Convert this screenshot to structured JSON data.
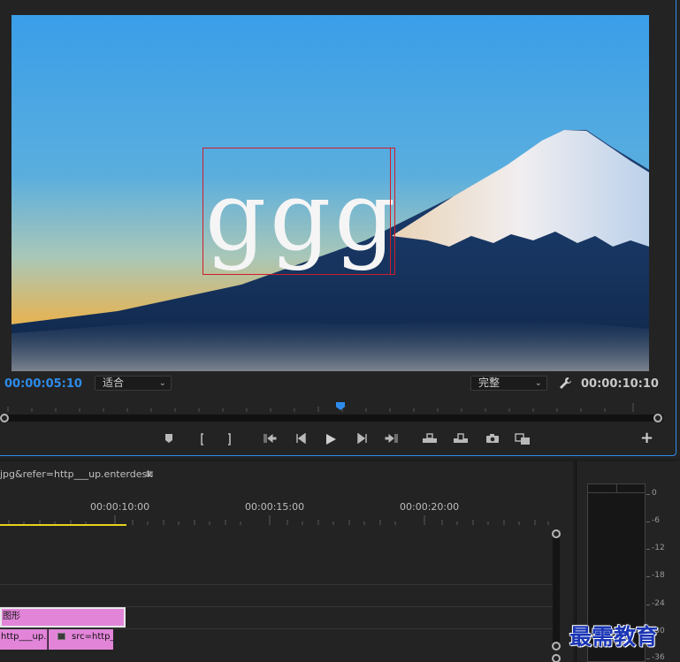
{
  "program_monitor": {
    "overlay_text": "ggg",
    "current_timecode": "00:00:05:10",
    "duration_timecode": "00:00:10:10",
    "zoom_select": "适合",
    "resolution_select": "完整",
    "accent_color": "#2d8ceb"
  },
  "timeline": {
    "sequence_name": "jpg&refer=http___up.enterdesk",
    "menu_icon": "≡",
    "ruler_labels": [
      "00:00:10:00",
      "00:00:15:00",
      "00:00:20:00"
    ],
    "clips": {
      "graphic": "图形",
      "video_1": "http___up.e",
      "video_2": "src=http_"
    },
    "clip_color": "#e285d9",
    "workarea_color": "#e6d21e"
  },
  "audio_meter": {
    "scale": [
      "0",
      "-6",
      "-12",
      "-18",
      "-24",
      "-30",
      "-36"
    ]
  },
  "watermark": "最需教育"
}
